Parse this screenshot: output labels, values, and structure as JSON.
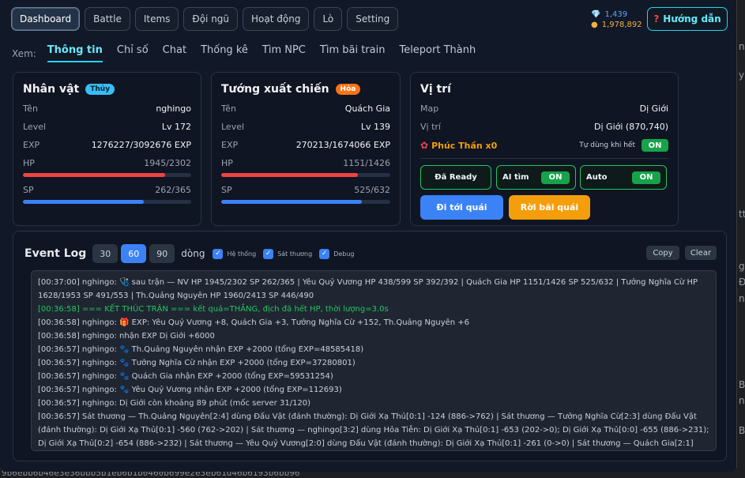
{
  "nav": {
    "tabs": [
      "Dashboard",
      "Battle",
      "Items",
      "Đội ngũ",
      "Hoạt động",
      "Lò",
      "Setting"
    ],
    "active": "Dashboard"
  },
  "currency": {
    "gems": "1,439",
    "coins": "1,978,892"
  },
  "guide_button": "Hướng dẫn",
  "subtabs": {
    "label": "Xem:",
    "items": [
      "Thông tin",
      "Chỉ số",
      "Chat",
      "Thống kê",
      "Tìm NPC",
      "Tìm bãi train",
      "Teleport Thành"
    ],
    "active": "Thông tin"
  },
  "character": {
    "title": "Nhân vật",
    "element": "Thủy",
    "name_label": "Tên",
    "name": "nghingo",
    "level_label": "Level",
    "level": "Lv 172",
    "exp_label": "EXP",
    "exp": "1276227/3092676 EXP",
    "hp_label": "HP",
    "hp": "1945/2302",
    "hp_ratio": 0.845,
    "sp_label": "SP",
    "sp": "262/365",
    "sp_ratio": 0.718
  },
  "general": {
    "title": "Tướng xuất chiến",
    "element": "Hỏa",
    "name_label": "Tên",
    "name": "Quách Gia",
    "level_label": "Level",
    "level": "Lv 139",
    "exp_label": "EXP",
    "exp": "270213/1674066 EXP",
    "hp_label": "HP",
    "hp": "1151/1426",
    "hp_ratio": 0.807,
    "sp_label": "SP",
    "sp": "525/632",
    "sp_ratio": 0.831
  },
  "location": {
    "title": "Vị trí",
    "map_label": "Map",
    "map": "Dị Giới",
    "pos_label": "Vị trí",
    "pos": "Dị Giới (870,740)",
    "item": "Phúc Thần x0",
    "auto_use_label": "Tự dùng khi hết",
    "auto_use": "ON",
    "ready": "Đã Ready",
    "ai_label": "AI tìm",
    "ai": "ON",
    "auto_label": "Auto",
    "auto": "ON",
    "go_button": "Đi tới quái",
    "leave_button": "Rời bãi quái"
  },
  "event_log": {
    "title": "Event Log",
    "counts": [
      "30",
      "60",
      "90"
    ],
    "active_count": "60",
    "unit": "dòng",
    "filters": [
      "Hệ thống",
      "Sát thương",
      "Debug"
    ],
    "copy": "Copy",
    "clear": "Clear",
    "lines": [
      {
        "text": "[00:37:00] nghingo: 🩺 sau trận — NV HP 1945/2302 SP 262/365 | Yêu Quỷ Vương HP 438/599 SP 392/392 | Quách Gia HP 1151/1426 SP 525/632 | Tưởng Nghĩa Cừ HP 1628/1953 SP 491/553 | Th.Quảng Nguyên HP 1960/2413 SP 446/490",
        "color": ""
      },
      {
        "text": "[00:36:58] === KẾT THÚC TRẬN === kết quả=THẮNG, địch đã hết HP, thời lượng=3.0s",
        "color": "green"
      },
      {
        "text": "[00:36:58] nghingo: 🎁 EXP: Yêu Quỷ Vương +8, Quách Gia +3, Tưởng Nghĩa Cừ +152, Th.Quảng Nguyên +6",
        "color": ""
      },
      {
        "text": "[00:36:58] nghingo: nhận EXP Dị Giới +6000",
        "color": ""
      },
      {
        "text": "[00:36:57] nghingo: 🐾 Th.Quảng Nguyên nhận EXP +2000 (tổng EXP=48585418)",
        "color": ""
      },
      {
        "text": "[00:36:57] nghingo: 🐾 Tưởng Nghĩa Cừ nhận EXP +2000 (tổng EXP=37280801)",
        "color": ""
      },
      {
        "text": "[00:36:57] nghingo: 🐾 Quách Gia nhận EXP +2000 (tổng EXP=59531254)",
        "color": ""
      },
      {
        "text": "[00:36:57] nghingo: 🐾 Yêu Quỷ Vương nhận EXP +2000 (tổng EXP=112693)",
        "color": ""
      },
      {
        "text": "[00:36:57] nghingo: Dị Giới còn khoảng 89 phút (mốc server 31/120)",
        "color": ""
      },
      {
        "text": "[00:36:57] Sát thương — Th.Quảng Nguyên[2:4] dùng Đấu Vật (đánh thường): Dị Giới Xạ Thủ[0:1] -124 (886->762) | Sát thương — Tưởng Nghĩa Cừ[2:3] dùng Đấu Vật (đánh thường): Dị Giới Xạ Thủ[0:1] -560 (762->202) | Sát thương — nghingo[3:2] dùng Hỏa Tiễn: Dị Giới Xạ Thủ[0:1] -653 (202->0); Dị Giới Xạ Thủ[0:0] -655 (886->231); Dị Giới Xạ Thủ[0:2] -654 (886->232) | Sát thương — Yêu Quỷ Vương[2:0] dùng Đấu Vật (đánh thường): Dị Giới Xạ Thủ[0:1] -261 (0->0) | Sát thương — Quách Gia[2:1]",
        "color": ""
      }
    ]
  },
  "background": {
    "bottom_strip": "9b6ebb6b46e3e36bbb5b1eb6b1b0460b699e2e3eb61d46b6193b6bb96",
    "right_strip": [
      "n",
      "y",
      "tt",
      "gi",
      "Đe",
      "nl",
      "B",
      "nl",
      "B"
    ]
  }
}
